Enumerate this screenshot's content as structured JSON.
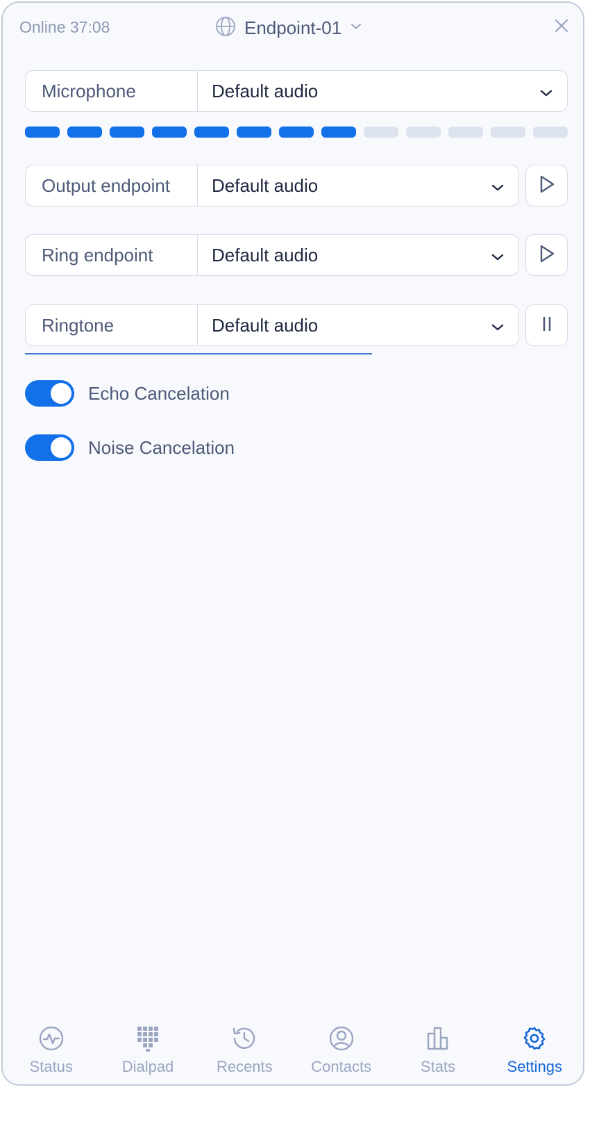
{
  "header": {
    "status": "Online 37:08",
    "endpoint": "Endpoint-01",
    "icons": {
      "endpoint": "globe-icon",
      "dropdown": "chevron-down-icon",
      "close": "close-icon"
    }
  },
  "settings": {
    "microphone": {
      "label": "Microphone",
      "value": "Default audio"
    },
    "mic_level": {
      "segments": 13,
      "active": 8
    },
    "output": {
      "label": "Output endpoint",
      "value": "Default audio",
      "action_icon": "play-icon"
    },
    "ring": {
      "label": "Ring endpoint",
      "value": "Default audio",
      "action_icon": "play-icon"
    },
    "ringtone": {
      "label": "Ringtone",
      "value": "Default audio",
      "action_icon": "pause-icon",
      "playback_progress": 0.64
    },
    "echo": {
      "label": "Echo Cancelation",
      "enabled": true
    },
    "noise": {
      "label": "Noise Cancelation",
      "enabled": true
    }
  },
  "tabs": [
    {
      "label": "Status",
      "icon": "activity-icon"
    },
    {
      "label": "Dialpad",
      "icon": "dialpad-icon"
    },
    {
      "label": "Recents",
      "icon": "history-icon"
    },
    {
      "label": "Contacts",
      "icon": "contact-icon"
    },
    {
      "label": "Stats",
      "icon": "bar-chart-icon"
    },
    {
      "label": "Settings",
      "icon": "gear-icon",
      "active": true
    }
  ],
  "colors": {
    "accent": "#1270e8",
    "active_tab": "#1265d6",
    "muted_text": "#8e99b4",
    "body_text": "#4d5a78"
  }
}
